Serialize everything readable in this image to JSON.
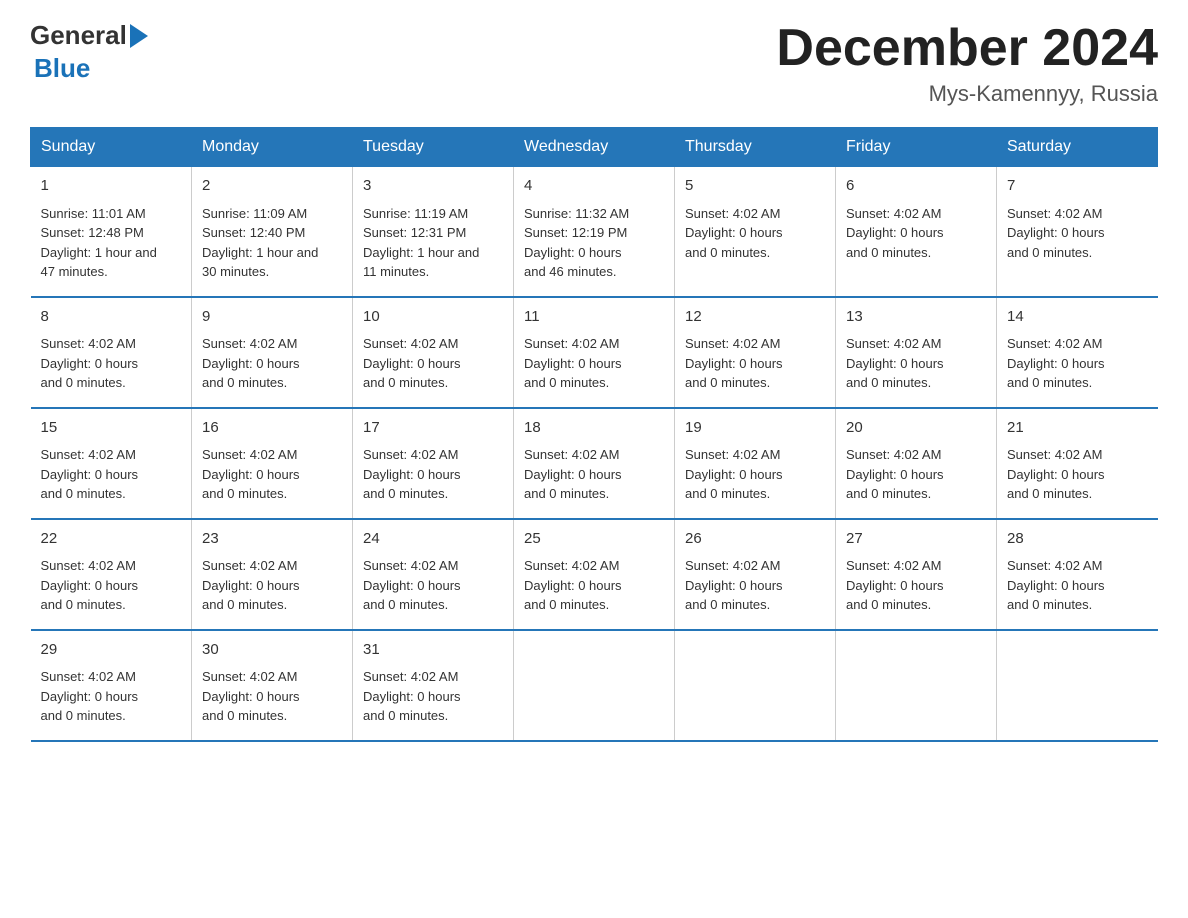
{
  "header": {
    "logo_general": "General",
    "logo_blue": "Blue",
    "month": "December 2024",
    "location": "Mys-Kamennyy, Russia"
  },
  "days_of_week": [
    "Sunday",
    "Monday",
    "Tuesday",
    "Wednesday",
    "Thursday",
    "Friday",
    "Saturday"
  ],
  "weeks": [
    [
      {
        "day": "1",
        "info": "Sunrise: 11:01 AM\nSunset: 12:48 PM\nDaylight: 1 hour and\n47 minutes."
      },
      {
        "day": "2",
        "info": "Sunrise: 11:09 AM\nSunset: 12:40 PM\nDaylight: 1 hour and\n30 minutes."
      },
      {
        "day": "3",
        "info": "Sunrise: 11:19 AM\nSunset: 12:31 PM\nDaylight: 1 hour and\n11 minutes."
      },
      {
        "day": "4",
        "info": "Sunrise: 11:32 AM\nSunset: 12:19 PM\nDaylight: 0 hours\nand 46 minutes."
      },
      {
        "day": "5",
        "info": "Sunset: 4:02 AM\nDaylight: 0 hours\nand 0 minutes."
      },
      {
        "day": "6",
        "info": "Sunset: 4:02 AM\nDaylight: 0 hours\nand 0 minutes."
      },
      {
        "day": "7",
        "info": "Sunset: 4:02 AM\nDaylight: 0 hours\nand 0 minutes."
      }
    ],
    [
      {
        "day": "8",
        "info": "Sunset: 4:02 AM\nDaylight: 0 hours\nand 0 minutes."
      },
      {
        "day": "9",
        "info": "Sunset: 4:02 AM\nDaylight: 0 hours\nand 0 minutes."
      },
      {
        "day": "10",
        "info": "Sunset: 4:02 AM\nDaylight: 0 hours\nand 0 minutes."
      },
      {
        "day": "11",
        "info": "Sunset: 4:02 AM\nDaylight: 0 hours\nand 0 minutes."
      },
      {
        "day": "12",
        "info": "Sunset: 4:02 AM\nDaylight: 0 hours\nand 0 minutes."
      },
      {
        "day": "13",
        "info": "Sunset: 4:02 AM\nDaylight: 0 hours\nand 0 minutes."
      },
      {
        "day": "14",
        "info": "Sunset: 4:02 AM\nDaylight: 0 hours\nand 0 minutes."
      }
    ],
    [
      {
        "day": "15",
        "info": "Sunset: 4:02 AM\nDaylight: 0 hours\nand 0 minutes."
      },
      {
        "day": "16",
        "info": "Sunset: 4:02 AM\nDaylight: 0 hours\nand 0 minutes."
      },
      {
        "day": "17",
        "info": "Sunset: 4:02 AM\nDaylight: 0 hours\nand 0 minutes."
      },
      {
        "day": "18",
        "info": "Sunset: 4:02 AM\nDaylight: 0 hours\nand 0 minutes."
      },
      {
        "day": "19",
        "info": "Sunset: 4:02 AM\nDaylight: 0 hours\nand 0 minutes."
      },
      {
        "day": "20",
        "info": "Sunset: 4:02 AM\nDaylight: 0 hours\nand 0 minutes."
      },
      {
        "day": "21",
        "info": "Sunset: 4:02 AM\nDaylight: 0 hours\nand 0 minutes."
      }
    ],
    [
      {
        "day": "22",
        "info": "Sunset: 4:02 AM\nDaylight: 0 hours\nand 0 minutes."
      },
      {
        "day": "23",
        "info": "Sunset: 4:02 AM\nDaylight: 0 hours\nand 0 minutes."
      },
      {
        "day": "24",
        "info": "Sunset: 4:02 AM\nDaylight: 0 hours\nand 0 minutes."
      },
      {
        "day": "25",
        "info": "Sunset: 4:02 AM\nDaylight: 0 hours\nand 0 minutes."
      },
      {
        "day": "26",
        "info": "Sunset: 4:02 AM\nDaylight: 0 hours\nand 0 minutes."
      },
      {
        "day": "27",
        "info": "Sunset: 4:02 AM\nDaylight: 0 hours\nand 0 minutes."
      },
      {
        "day": "28",
        "info": "Sunset: 4:02 AM\nDaylight: 0 hours\nand 0 minutes."
      }
    ],
    [
      {
        "day": "29",
        "info": "Sunset: 4:02 AM\nDaylight: 0 hours\nand 0 minutes."
      },
      {
        "day": "30",
        "info": "Sunset: 4:02 AM\nDaylight: 0 hours\nand 0 minutes."
      },
      {
        "day": "31",
        "info": "Sunset: 4:02 AM\nDaylight: 0 hours\nand 0 minutes."
      },
      {
        "day": "",
        "info": ""
      },
      {
        "day": "",
        "info": ""
      },
      {
        "day": "",
        "info": ""
      },
      {
        "day": "",
        "info": ""
      }
    ]
  ]
}
